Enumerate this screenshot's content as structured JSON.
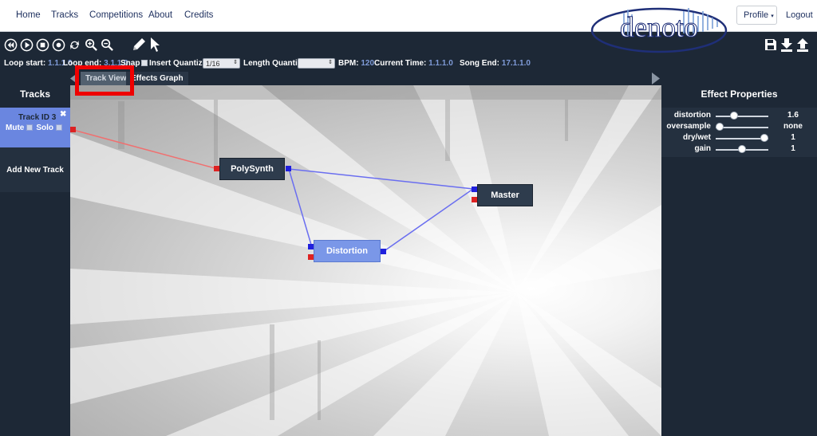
{
  "nav": {
    "links": [
      "Home",
      "Tracks",
      "Competitions",
      "About",
      "Credits"
    ],
    "profile_label": "Profile",
    "profile_caret": "▾",
    "logout_label": "Logout",
    "logo_text": "denoto"
  },
  "toolbar": {
    "icons": [
      "rewind-icon",
      "play-icon",
      "stop-icon",
      "record-icon",
      "loop-icon",
      "zoom-in-icon",
      "zoom-out-icon",
      "pencil-icon",
      "pointer-icon"
    ],
    "right_icons": [
      "save-icon",
      "download-icon",
      "upload-icon"
    ],
    "loop_start_label": "Loop start:",
    "loop_start_value": "1.1.1.0",
    "loop_end_label": "Loop end:",
    "loop_end_value": "3.1.1.0",
    "snap_label": "Snap",
    "snap_checked": true,
    "insert_quantize_label": "Insert Quantize:",
    "insert_quantize_value": "1/16",
    "length_quantize_label": "Length Quantize:",
    "length_quantize_value": "",
    "bpm_label": "BPM:",
    "bpm_value": "120",
    "current_time_label": "Current Time:",
    "current_time_value": "1.1.1.0",
    "song_end_label": "Song End:",
    "song_end_value": "17.1.1.0"
  },
  "tabs": {
    "track_view": "Track View",
    "effects_graph": "Effects Graph"
  },
  "tracks_panel": {
    "title": "Tracks",
    "items": [
      {
        "name": "Track ID 3",
        "mute_label": "Mute",
        "solo_label": "Solo",
        "close_symbol": "✖"
      }
    ],
    "add_label": "Add New Track"
  },
  "graph": {
    "nodes": [
      {
        "label": "PolySynth"
      },
      {
        "label": "Distortion"
      },
      {
        "label": "Master"
      }
    ]
  },
  "effect_properties": {
    "title": "Effect Properties",
    "params": [
      {
        "name": "distortion",
        "value": "1.6",
        "level": 0.33
      },
      {
        "name": "oversample",
        "value": "none",
        "level": 0.0
      },
      {
        "name": "dry/wet",
        "value": "1",
        "level": 1.0
      },
      {
        "name": "gain",
        "value": "1",
        "level": 0.5
      }
    ]
  },
  "colors": {
    "accent": "#6a86e0",
    "background": "#1d2836",
    "nav_text": "#1d2f5e",
    "value_text": "#7f9bd8",
    "input_port": "#dd2222",
    "output_port": "#2020dd",
    "highlight": "#ee0000"
  }
}
